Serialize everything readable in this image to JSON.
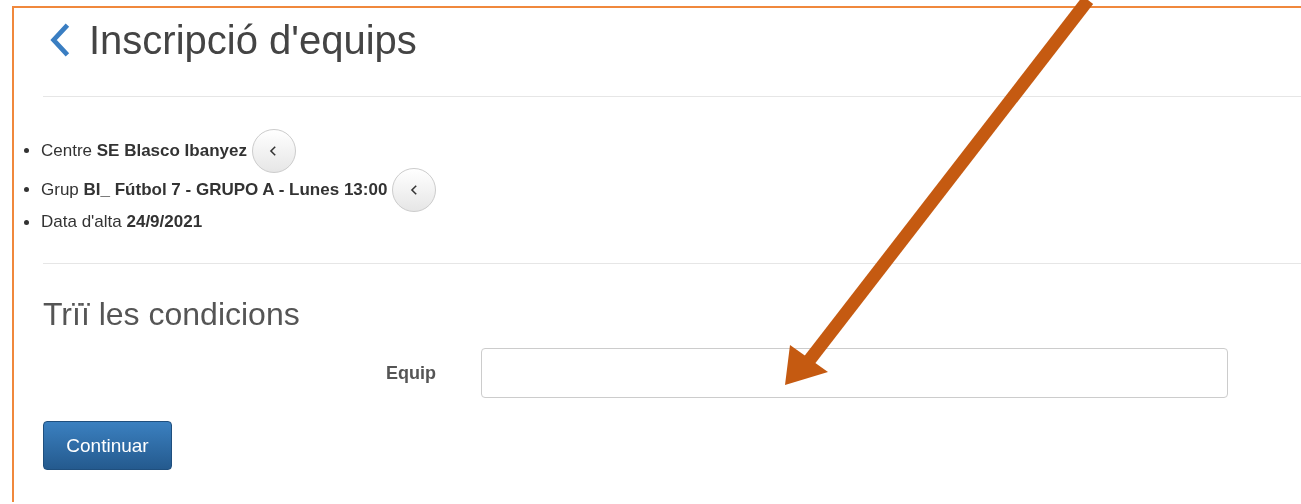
{
  "page": {
    "title": "Inscripció d'equips"
  },
  "details": [
    {
      "label": "Centre",
      "value": "SE Blasco Ibanyez",
      "has_back": true
    },
    {
      "label": "Grup",
      "value": "BI_ Fútbol 7 - GRUPO A - Lunes 13:00",
      "has_back": true
    },
    {
      "label": "Data d'alta",
      "value": "24/9/2021",
      "has_back": false
    }
  ],
  "section": {
    "title": "Trïï les condicions"
  },
  "form": {
    "fields": [
      {
        "label": "Equip"
      }
    ],
    "submit": "Continuar"
  },
  "annotation": {
    "kind": "arrow"
  }
}
